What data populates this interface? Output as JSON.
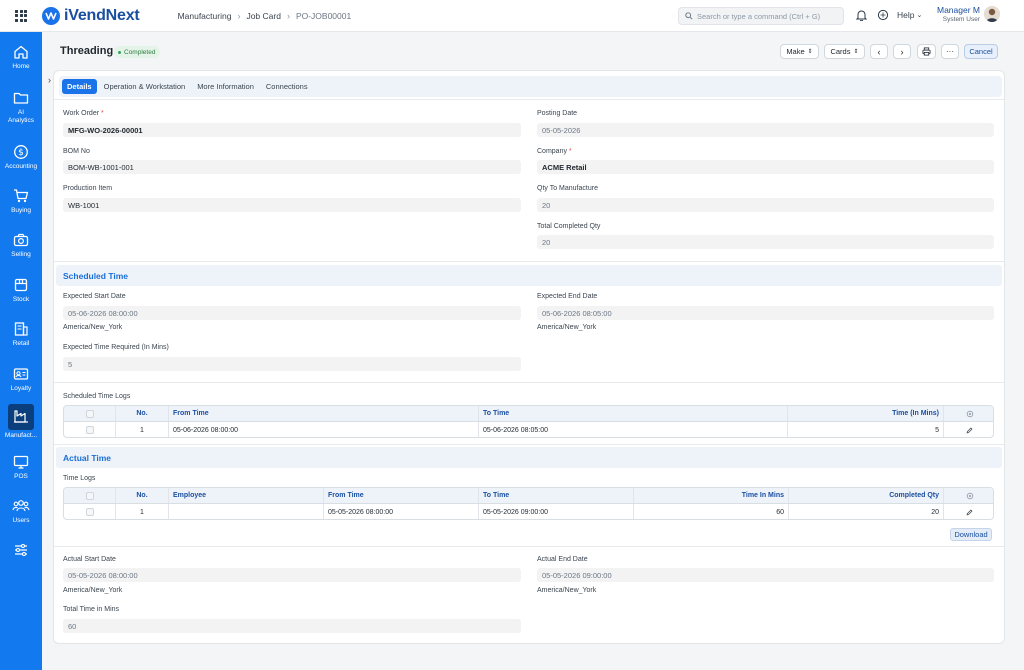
{
  "app": {
    "brand": "iVendNext"
  },
  "breadcrumbs": [
    "Manufacturing",
    "Job Card",
    "PO-JOB00001"
  ],
  "search": {
    "placeholder": "Search or type a command (Ctrl + G)"
  },
  "help_label": "Help",
  "user": {
    "name": "Manager M",
    "role": "System User"
  },
  "sidebar": {
    "items": [
      {
        "label": "Home",
        "icon": "home-icon"
      },
      {
        "label": "AI Analytics",
        "icon": "folder-icon"
      },
      {
        "label": "Accounting",
        "icon": "dollar-icon"
      },
      {
        "label": "Buying",
        "icon": "cart-icon"
      },
      {
        "label": "Selling",
        "icon": "camera-icon"
      },
      {
        "label": "Stock",
        "icon": "box-icon"
      },
      {
        "label": "Retail",
        "icon": "store-icon"
      },
      {
        "label": "Loyalty",
        "icon": "id-card-icon"
      },
      {
        "label": "Manufact...",
        "icon": "factory-icon"
      },
      {
        "label": "POS",
        "icon": "monitor-icon"
      },
      {
        "label": "Users",
        "icon": "users-icon"
      },
      {
        "label": "",
        "icon": "sliders-icon"
      }
    ]
  },
  "page": {
    "title": "Threading",
    "status": "Completed",
    "buttons": {
      "make": "Make",
      "cards": "Cards",
      "cancel": "Cancel"
    }
  },
  "tabs": [
    "Details",
    "Operation & Workstation",
    "More Information",
    "Connections"
  ],
  "details": {
    "work_order": {
      "label": "Work Order",
      "value": "MFG-WO-2026-00001"
    },
    "bom_no": {
      "label": "BOM No",
      "value": "BOM-WB-1001-001"
    },
    "production_item": {
      "label": "Production Item",
      "value": "WB-1001"
    },
    "posting_date": {
      "label": "Posting Date",
      "value": "05-05-2026"
    },
    "company": {
      "label": "Company",
      "value": "ACME Retail"
    },
    "qty_to_manufacture": {
      "label": "Qty To Manufacture",
      "value": "20"
    },
    "total_completed_qty": {
      "label": "Total Completed Qty",
      "value": "20"
    }
  },
  "scheduled": {
    "heading": "Scheduled Time",
    "expected_start": {
      "label": "Expected Start Date",
      "value": "05-06-2026 08:00:00",
      "tz": "America/New_York"
    },
    "expected_end": {
      "label": "Expected End Date",
      "value": "05-06-2026 08:05:00",
      "tz": "America/New_York"
    },
    "time_required": {
      "label": "Expected Time Required (In Mins)",
      "value": "5"
    },
    "logs_label": "Scheduled Time Logs",
    "logs_columns": [
      "No.",
      "From Time",
      "To Time",
      "Time (In Mins)"
    ],
    "logs_rows": [
      {
        "no": "1",
        "from": "05-06-2026 08:00:00",
        "to": "05-06-2026 08:05:00",
        "mins": "5"
      }
    ]
  },
  "actual": {
    "heading": "Actual Time",
    "logs_label": "Time Logs",
    "logs_columns": [
      "No.",
      "Employee",
      "From Time",
      "To Time",
      "Time In Mins",
      "Completed Qty"
    ],
    "logs_rows": [
      {
        "no": "1",
        "employee": "",
        "from": "05-05-2026 08:00:00",
        "to": "05-05-2026 09:00:00",
        "mins": "60",
        "qty": "20"
      }
    ],
    "download_label": "Download",
    "actual_start": {
      "label": "Actual Start Date",
      "value": "05-05-2026 08:00:00",
      "tz": "America/New_York"
    },
    "actual_end": {
      "label": "Actual End Date",
      "value": "05-05-2026 09:00:00",
      "tz": "America/New_York"
    },
    "total_time": {
      "label": "Total Time in Mins",
      "value": "60"
    }
  },
  "colors": {
    "sidebar": "#1379ef",
    "accent": "#1a73e8",
    "status_bg": "#e5f4e9"
  }
}
